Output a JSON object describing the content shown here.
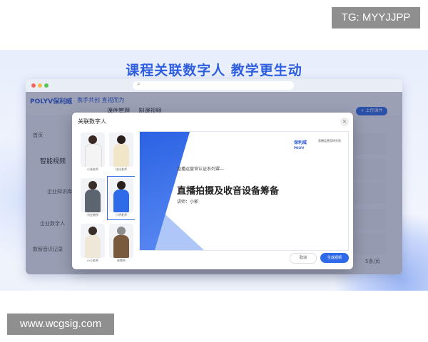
{
  "watermark_top": "TG: MYYJJPP",
  "watermark_bottom": "www.wcgsig.com",
  "headline": "课程关联数字人  教学更生动",
  "app": {
    "logo": "POLYV保利威",
    "slogan": "携手共创 直视而为",
    "tabs": [
      "课件管理",
      "制课视频"
    ],
    "upload_label": "+ 上传课件",
    "sidebar": [
      "首页",
      "智能视频",
      "企业知识库",
      "企业数字人",
      "数智音识记录"
    ],
    "pager": "5条/页"
  },
  "modal": {
    "title": "关联数字人",
    "close": "×",
    "people": [
      {
        "name": "小张老师"
      },
      {
        "name": "佳佳老师"
      },
      {
        "name": "刘金教授"
      },
      {
        "name": "小明老师"
      },
      {
        "name": "小王老师"
      },
      {
        "name": "老教师"
      }
    ],
    "preview": {
      "series": "直播运营官认证系列课—",
      "title": "直播拍摄及收音设备筹备",
      "teacher": "讲师：小郭",
      "brand": "保利威",
      "brand_sub": "POLYV",
      "institute": "直播运营官研究院"
    },
    "cancel": "取消",
    "generate": "生成视频"
  }
}
